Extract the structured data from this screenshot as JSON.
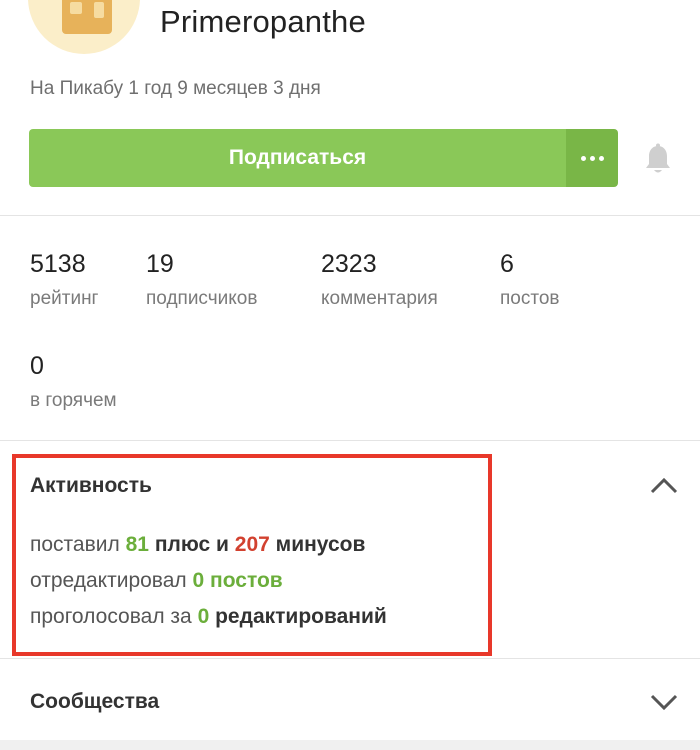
{
  "profile": {
    "username": "Primeropanthe",
    "since": "На Пикабу 1 год 9 месяцев 3 дня"
  },
  "actions": {
    "subscribe_label": "Подписаться",
    "accent": "#8ac858"
  },
  "stats": [
    {
      "value": "5138",
      "label": "рейтинг"
    },
    {
      "value": "19",
      "label": "подписчиков"
    },
    {
      "value": "2323",
      "label": "комментария"
    },
    {
      "value": "6",
      "label": "постов"
    },
    {
      "value": "0",
      "label": "в горячем"
    }
  ],
  "activity": {
    "title": "Активность",
    "line1": {
      "a": "поставил",
      "plus": "81",
      "b": "плюс и",
      "minus": "207",
      "c": "минусов"
    },
    "line2": {
      "a": "отредактировал",
      "num": "0",
      "b": "постов"
    },
    "line3": {
      "a": "проголосовал за",
      "num": "0",
      "b": "редактирований"
    }
  },
  "communities": {
    "title": "Сообщества"
  },
  "icons": {
    "more": "more-dots-icon",
    "bell": "bell-icon",
    "collapse": "chevron-up-icon",
    "expand": "chevron-down-icon"
  }
}
